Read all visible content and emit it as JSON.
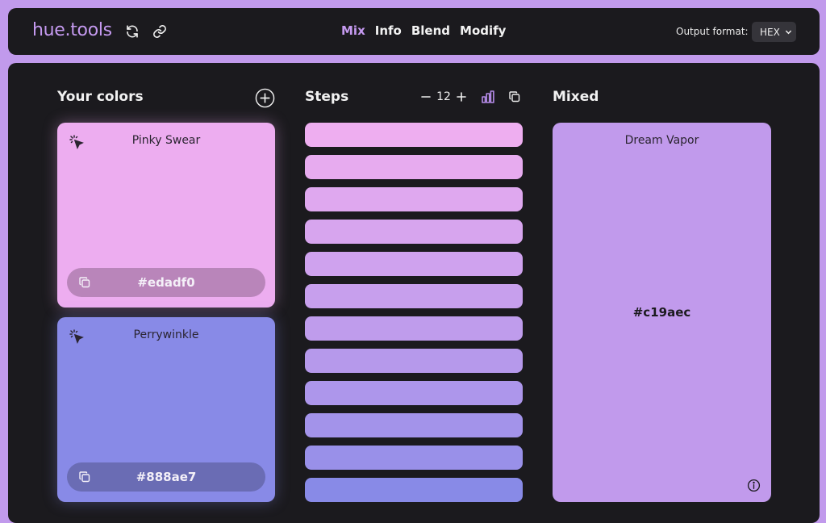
{
  "header": {
    "brand": "hue.tools",
    "icons": [
      "refresh-icon",
      "link-icon"
    ],
    "nav": [
      {
        "label": "Mix",
        "active": true
      },
      {
        "label": "Info",
        "active": false
      },
      {
        "label": "Blend",
        "active": false
      },
      {
        "label": "Modify",
        "active": false
      }
    ],
    "output_format_label": "Output format:",
    "output_format_value": "HEX"
  },
  "your_colors": {
    "title": "Your colors",
    "colors": [
      {
        "name": "Pinky Swear",
        "hex": "#edadf0",
        "color": "#edadf0",
        "pill": "#b985ba"
      },
      {
        "name": "Perrywinkle",
        "hex": "#888ae7",
        "color": "#888ae7",
        "pill": "#6a6cb4"
      }
    ]
  },
  "steps": {
    "title": "Steps",
    "count": "12",
    "colors": [
      "#eeaef0",
      "#e7abef",
      "#dfa8ef",
      "#d7a5ee",
      "#cfa2ee",
      "#c79fed",
      "#bf9cec",
      "#b699eb",
      "#ad96eb",
      "#a393ea",
      "#9990e9",
      "#888ae7"
    ]
  },
  "mixed": {
    "title": "Mixed",
    "name": "Dream Vapor",
    "hex": "#c19aec"
  }
}
